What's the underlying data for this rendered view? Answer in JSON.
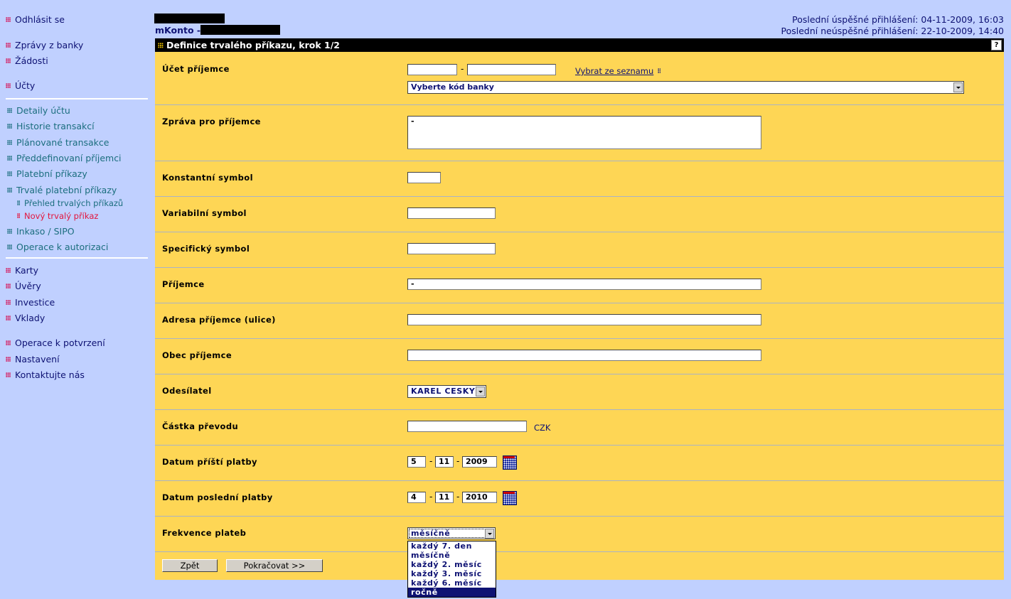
{
  "sidebar": {
    "logout": "Odhlásit se",
    "group1": [
      "Zprávy z banky",
      "Žádosti"
    ],
    "accounts": "Účty",
    "account_items": [
      "Detaily účtu",
      "Historie transakcí",
      "Plánované transakce",
      "Předdefinovaní příjemci",
      "Platební příkazy",
      "Trvalé platební příkazy"
    ],
    "standing_sub": [
      "Přehled trvalých příkazů",
      "Nový trvalý příkaz"
    ],
    "account_items2": [
      "Inkaso / SIPO",
      "Operace k autorizaci"
    ],
    "group3": [
      "Karty",
      "Úvěry",
      "Investice",
      "Vklady"
    ],
    "group4": [
      "Operace k potvrzení",
      "Nastavení",
      "Kontaktujte nás"
    ]
  },
  "header": {
    "mkonto": "mKonto -",
    "last_success": "Poslední úspěšné přihlášení: 04-11-2009, 16:03",
    "last_fail": "Poslední neúspěšné přihlášení: 22-10-2009, 14:40"
  },
  "form": {
    "title": "Definice trvalého příkazu, krok 1/2",
    "help": "?",
    "labels": {
      "recipient_account": "Účet příjemce",
      "message": "Zpráva pro příjemce",
      "constant_symbol": "Konstantní symbol",
      "variable_symbol": "Variabilní symbol",
      "specific_symbol": "Specifický symbol",
      "recipient": "Příjemce",
      "recipient_address": "Adresa příjemce (ulice)",
      "recipient_city": "Obec příjemce",
      "sender": "Odesílatel",
      "amount": "Částka převodu",
      "next_payment": "Datum příští platby",
      "last_payment": "Datum poslední platby",
      "frequency": "Frekvence plateb"
    },
    "values": {
      "account_prefix": "",
      "account_number": "",
      "bank_code": "Vyberte kód banky",
      "message": "-",
      "constant_symbol": "",
      "variable_symbol": "",
      "specific_symbol": "",
      "recipient": "-",
      "recipient_address": "",
      "recipient_city": "",
      "sender": "KAREL CESKY",
      "amount": "",
      "currency": "CZK",
      "next_day": "5",
      "next_month": "11",
      "next_year": "2009",
      "last_day": "4",
      "last_month": "11",
      "last_year": "2010",
      "frequency": "měsíčně"
    },
    "select_from_list": "Vybrat ze seznamu",
    "date_sep": "-",
    "frequency_options": [
      "každý 7. den",
      "měsíčně",
      "každý 2. měsíc",
      "každý 3. měsíc",
      "každý 6. měsíc",
      "ročně"
    ],
    "frequency_highlighted": "ročně",
    "back_button": "Zpět",
    "continue_button": "Pokračovat >>"
  },
  "colors": {
    "page_bg": "#c0d0ff",
    "form_bg": "#fed655",
    "nav_main": "#0e1273",
    "nav_sub": "#1b6e7e",
    "nav_active": "#e3143c",
    "bullet": "#d4185c"
  }
}
